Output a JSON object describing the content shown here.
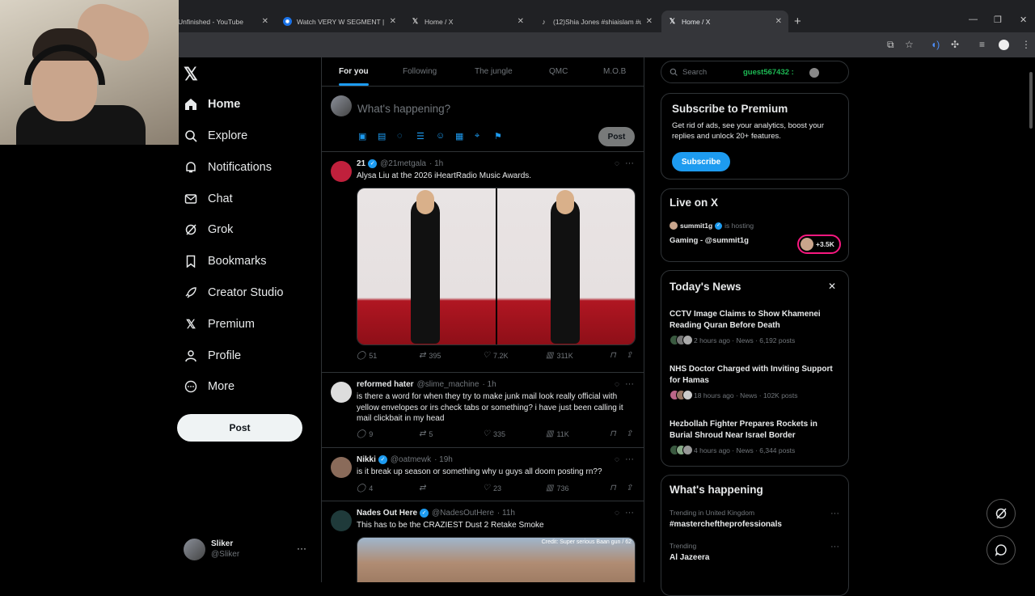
{
  "browser": {
    "tabs": [
      {
        "title": "Unfinished - YouTube",
        "favicon": "youtube-icon"
      },
      {
        "title": "Watch VERY W SEGMENT | Stre",
        "favicon": "stream-icon"
      },
      {
        "title": "Home / X",
        "favicon": "x-logo-icon"
      },
      {
        "title": "(12)Shia Jones #shiaislam #ufc",
        "favicon": "tiktok-icon"
      },
      {
        "title": "Home / X",
        "favicon": "x-logo-icon",
        "active": true
      }
    ],
    "new_tab": "+"
  },
  "nav": {
    "items": [
      {
        "label": "Home",
        "icon": "home-icon"
      },
      {
        "label": "Explore",
        "icon": "search-icon"
      },
      {
        "label": "Notifications",
        "icon": "bell-icon"
      },
      {
        "label": "Chat",
        "icon": "mail-icon"
      },
      {
        "label": "Grok",
        "icon": "grok-icon"
      },
      {
        "label": "Bookmarks",
        "icon": "bookmark-icon"
      },
      {
        "label": "Creator Studio",
        "icon": "rocket-icon"
      },
      {
        "label": "Premium",
        "icon": "x-logo-icon"
      },
      {
        "label": "Profile",
        "icon": "person-icon"
      },
      {
        "label": "More",
        "icon": "more-circle-icon"
      }
    ],
    "post_label": "Post",
    "account": {
      "name": "Sliker",
      "handle": "@Sliker"
    }
  },
  "feed": {
    "tabs": [
      "For you",
      "Following",
      "The jungle",
      "QMC",
      "M.O.B"
    ],
    "composer_placeholder": "What's happening?",
    "composer_post": "Post",
    "tweets": [
      {
        "name": "21",
        "handle": "@21metgala",
        "time": "· 1h",
        "verified": true,
        "text": "Alysa Liu at the 2026 iHeartRadio Music Awards.",
        "replies": "51",
        "reposts": "395",
        "likes": "7.2K",
        "views": "311K"
      },
      {
        "name": "reformed hater",
        "handle": "@slime_machine",
        "time": "· 1h",
        "verified": false,
        "text": "is there a word for when they try to make junk mail look really official with yellow envelopes or irs check tabs or something? i have just been calling it mail clickbait in my head",
        "replies": "9",
        "reposts": "5",
        "likes": "335",
        "views": "11K"
      },
      {
        "name": "Nikki",
        "handle": "@oatmewk",
        "time": "· 19h",
        "verified": true,
        "text": "is it break up season or something why u guys all doom posting rn??",
        "replies": "4",
        "reposts": "",
        "likes": "23",
        "views": "736"
      },
      {
        "name": "Nades Out Here",
        "handle": "@NadesOutHere",
        "time": "· 11h",
        "verified": true,
        "text": "This has to be the CRAZIEST Dust 2 Retake Smoke",
        "media_caption": "Credit: Super serious Baan gun / 62"
      }
    ]
  },
  "sidebar": {
    "search_placeholder": "Search",
    "guest": "guest567432 :",
    "premium": {
      "title": "Subscribe to Premium",
      "body": "Get rid of ads, see your analytics, boost your replies and unlock 20+ features.",
      "button": "Subscribe"
    },
    "live": {
      "title": "Live on X",
      "host": "summit1g",
      "hosting": "is hosting",
      "stream": "Gaming - @summit1g",
      "count": "+3.5K"
    },
    "news": {
      "title": "Today's News",
      "items": [
        {
          "headline": "CCTV Image Claims to Show Khamenei Reading Quran Before Death",
          "meta": "2 hours ago · News · 6,192 posts"
        },
        {
          "headline": "NHS Doctor Charged with Inviting Support for Hamas",
          "meta": "18 hours ago · News · 102K posts"
        },
        {
          "headline": "Hezbollah Fighter Prepares Rockets in Burial Shroud Near Israel Border",
          "meta": "4 hours ago · News · 6,344 posts"
        }
      ]
    },
    "happening": {
      "title": "What's happening",
      "items": [
        {
          "context": "Trending in United Kingdom",
          "topic": "#mastercheftheprofessionals"
        },
        {
          "context": "Trending",
          "topic": "Al Jazeera"
        }
      ]
    }
  },
  "colors": {
    "accent": "#1d9bf0",
    "bg": "#000000",
    "border": "#2f3336",
    "muted": "#71767b"
  }
}
